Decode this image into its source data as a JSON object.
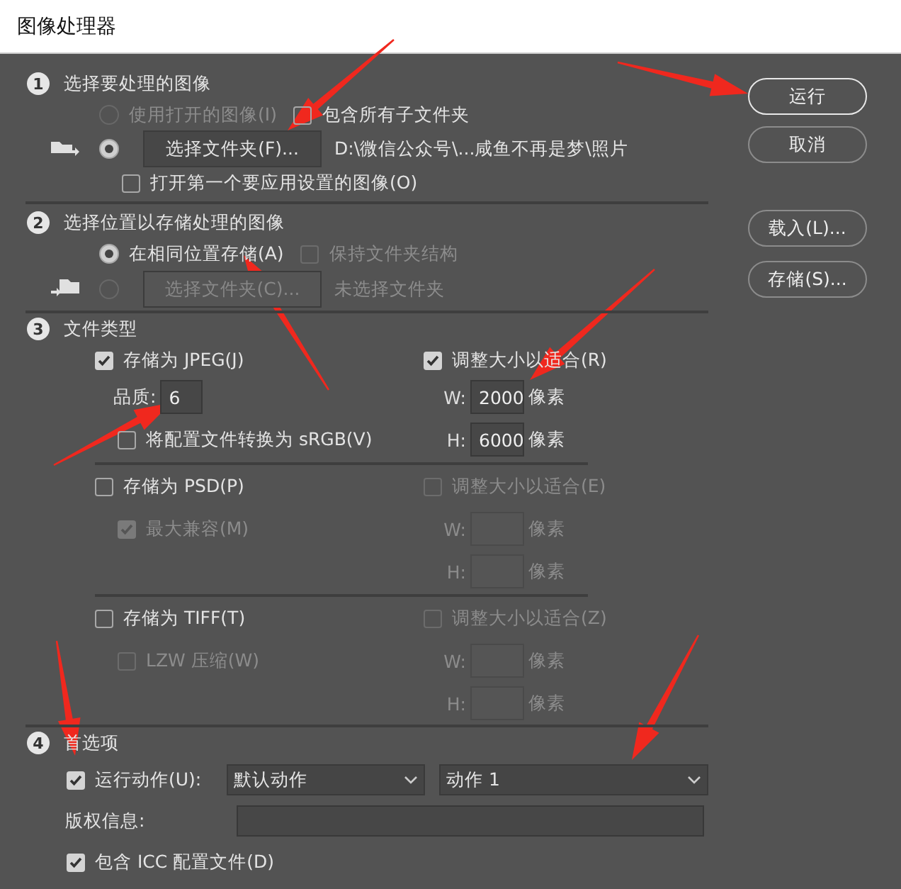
{
  "window": {
    "title": "图像处理器"
  },
  "source": {
    "number": "1",
    "title": "选择要处理的图像",
    "use_open": {
      "label": "使用打开的图像(I)",
      "selected": false,
      "disabled": true
    },
    "include_sub": {
      "label": "包含所有子文件夹",
      "checked": false
    },
    "folder": {
      "selected": true,
      "button": "选择文件夹(F)...",
      "path": "D:\\微信公众号\\...咸鱼不再是梦\\照片"
    },
    "open_first": {
      "label": "打开第一个要应用设置的图像(O)",
      "checked": false
    }
  },
  "destination": {
    "number": "2",
    "title": "选择位置以存储处理的图像",
    "same": {
      "label": "在相同位置存储(A)",
      "selected": true
    },
    "keep_structure": {
      "label": "保持文件夹结构",
      "checked": false,
      "disabled": true
    },
    "folder": {
      "selected": false,
      "disabled": true,
      "button": "选择文件夹(C)...",
      "path": "未选择文件夹"
    }
  },
  "file_types": {
    "number": "3",
    "title": "文件类型",
    "types": [
      {
        "kind": "jpeg",
        "label": "存储为 JPEG(J)",
        "checked": true,
        "quality_label": "品质:",
        "quality": "6",
        "option": {
          "label": "将配置文件转换为 sRGB(V)",
          "checked": false,
          "disabled": false
        },
        "resize": {
          "label": "调整大小以适合(R)",
          "checked": true,
          "disabled": false,
          "width": {
            "label": "W:",
            "value": "2000",
            "unit": "像素"
          },
          "height": {
            "label": "H:",
            "value": "6000",
            "unit": "像素"
          }
        }
      },
      {
        "kind": "option",
        "label": "存储为 PSD(P)",
        "checked": false,
        "option": {
          "label": "最大兼容(M)",
          "checked": true,
          "disabled": true
        },
        "resize": {
          "label": "调整大小以适合(E)",
          "checked": false,
          "disabled": true,
          "width": {
            "label": "W:",
            "unit": "像素"
          },
          "height": {
            "label": "H:",
            "unit": "像素"
          }
        }
      },
      {
        "kind": "option",
        "label": "存储为 TIFF(T)",
        "checked": false,
        "option": {
          "label": "LZW 压缩(W)",
          "checked": false,
          "disabled": true
        },
        "resize": {
          "label": "调整大小以适合(Z)",
          "checked": false,
          "disabled": true,
          "width": {
            "label": "W:",
            "unit": "像素"
          },
          "height": {
            "label": "H:",
            "unit": "像素"
          }
        }
      }
    ]
  },
  "preferences": {
    "number": "4",
    "title": "首选项",
    "run_action": {
      "label": "运行动作(U):",
      "checked": true,
      "set": "默认动作",
      "action": "动作 1"
    },
    "copyright": {
      "label": "版权信息:"
    },
    "icc": {
      "label": "包含 ICC 配置文件(D)",
      "checked": true
    }
  },
  "buttons": [
    {
      "label": "运行",
      "default": true
    },
    {
      "label": "取消",
      "default": false
    }
  ],
  "settings_buttons": [
    {
      "label": "载入(L)...",
      "default": false
    },
    {
      "label": "存储(S)...",
      "default": false
    }
  ]
}
